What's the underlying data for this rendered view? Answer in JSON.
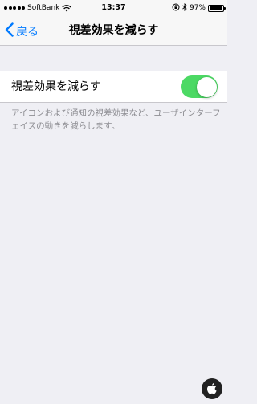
{
  "status_bar": {
    "carrier": "SoftBank",
    "time": "13:37",
    "battery_percent": "97%",
    "battery_level": 0.97,
    "icons": [
      "signal-dots-icon",
      "wifi-icon",
      "orientation-lock-icon",
      "bluetooth-icon",
      "battery-icon"
    ]
  },
  "nav": {
    "back_label": "戻る",
    "title": "視差効果を減らす"
  },
  "settings": {
    "reduce_motion_label": "視差効果を減らす",
    "reduce_motion_on": true,
    "footer": "アイコンおよび通知の視差効果など、ユーザインターフェイスの動きを減らします。"
  },
  "colors": {
    "accent": "#007aff",
    "toggle_on": "#4cd964",
    "background": "#efeff4",
    "footer_text": "#8e8e93"
  }
}
